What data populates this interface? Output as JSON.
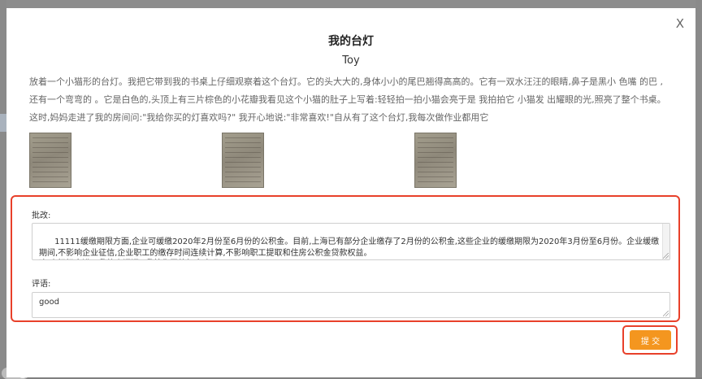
{
  "modal": {
    "close_label": "X",
    "title": "我的台灯",
    "author": "Toy",
    "content": "放着一个小猫形的台灯。我把它带到我的书桌上仔细观察着这个台灯。它的头大大的,身体小小的尾巴翘得高高的。它有一双水汪汪的眼睛,鼻子是黑小 色嘴 的巴 ,还有一个弯弯的 。它是白色的,头顶上有三片棕色的小花瓣我看见这个小猫的肚子上写着:轻轻拍一拍小猫会亮于是 我拍拍它 小猫发 出耀眼的光,照亮了整个书桌。 这时,妈妈走进了我的房间问:\"我给你买的灯喜欢吗?\" 我开心地说:\"非常喜欢!\"自从有了这个台灯,我每次做作业都用它"
  },
  "review": {
    "correction_label": "批改:",
    "correction_text": "11111缓缴期限方面,企业可缓缴2020年2月份至6月份的公积金。目前,上海已有部分企业缴存了2月份的公积金,这些企业的缓缴期限为2020年3月份至6月份。企业缓缴期间,不影响企业征信,企业职工的缴存时间连续计算,不影响职工提取和住房公积金贷款权益。\n这时,妈妈走进了我的房间问:\"我给你买的灯喜欢吗?\"",
    "comment_label": "评语:",
    "comment_text": "good"
  },
  "actions": {
    "submit_label": "提 交"
  },
  "colors": {
    "highlight": "#e8402a",
    "submit": "#f4961f"
  }
}
